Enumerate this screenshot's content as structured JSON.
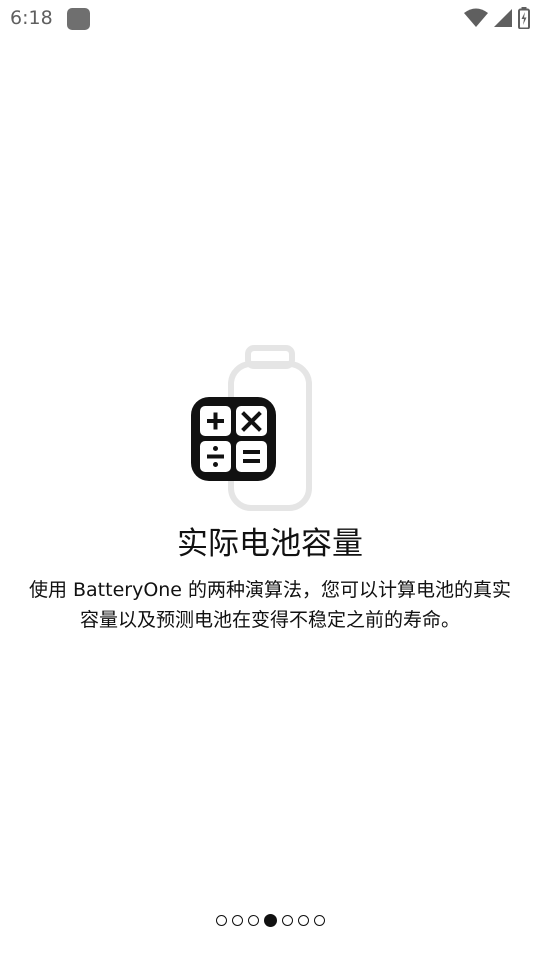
{
  "status_bar": {
    "time": "6:18",
    "icons": [
      "notification-icon",
      "wifi-icon",
      "cellular-icon",
      "battery-charging-icon"
    ]
  },
  "onboarding": {
    "illustration": {
      "icons": [
        "battery-outline-icon",
        "calculator-icon"
      ],
      "colors": {
        "battery": "#e5e5e5",
        "calculator": "#111111"
      }
    },
    "title": "实际电池容量",
    "description": "使用 BatteryOne 的两种演算法，您可以计算电池的真实容量以及预测电池在变得不稳定之前的寿命。"
  },
  "pager": {
    "total_pages": 7,
    "active_index": 3
  }
}
